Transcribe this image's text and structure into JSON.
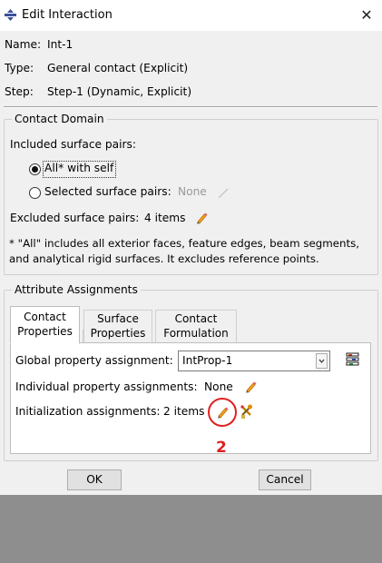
{
  "window": {
    "title": "Edit Interaction",
    "close_symbol": "✕"
  },
  "info": {
    "name_label": "Name:",
    "name_value": "Int-1",
    "type_label": "Type:",
    "type_value": "General contact (Explicit)",
    "step_label": "Step:",
    "step_value": "Step-1 (Dynamic, Explicit)"
  },
  "contact_domain": {
    "legend": "Contact Domain",
    "included_label": "Included surface pairs:",
    "option_all": "All* with self",
    "option_selected": "Selected surface pairs:",
    "selected_value": "None",
    "excluded_label": "Excluded surface pairs:",
    "excluded_value": "4 items",
    "note_line1": "* \"All\" includes all exterior faces, feature edges, beam segments,",
    "note_line2": "and analytical rigid surfaces. It excludes reference points."
  },
  "attribute_assignments": {
    "legend": "Attribute Assignments",
    "tabs": [
      {
        "line1": "Contact",
        "line2": "Properties",
        "active": true
      },
      {
        "line1": "Surface",
        "line2": "Properties",
        "active": false
      },
      {
        "line1": "Contact",
        "line2": "Formulation",
        "active": false
      }
    ],
    "global_label": "Global property assignment:",
    "global_value": "IntProp-1",
    "individual_label": "Individual property assignments:",
    "individual_value": "None",
    "initialization_label": "Initialization assignments:",
    "initialization_value": "2 items"
  },
  "buttons": {
    "ok": "OK",
    "cancel": "Cancel"
  },
  "annotation": {
    "number": "2",
    "color": "#e02020"
  },
  "icons": {
    "title": "abaqus-interaction-icon",
    "edit": "pencil-edit-icon",
    "disabled_edit": "disabled-pencil-icon",
    "property_manager": "property-manager-icon",
    "initialization_tool": "initialization-tool-icon"
  }
}
